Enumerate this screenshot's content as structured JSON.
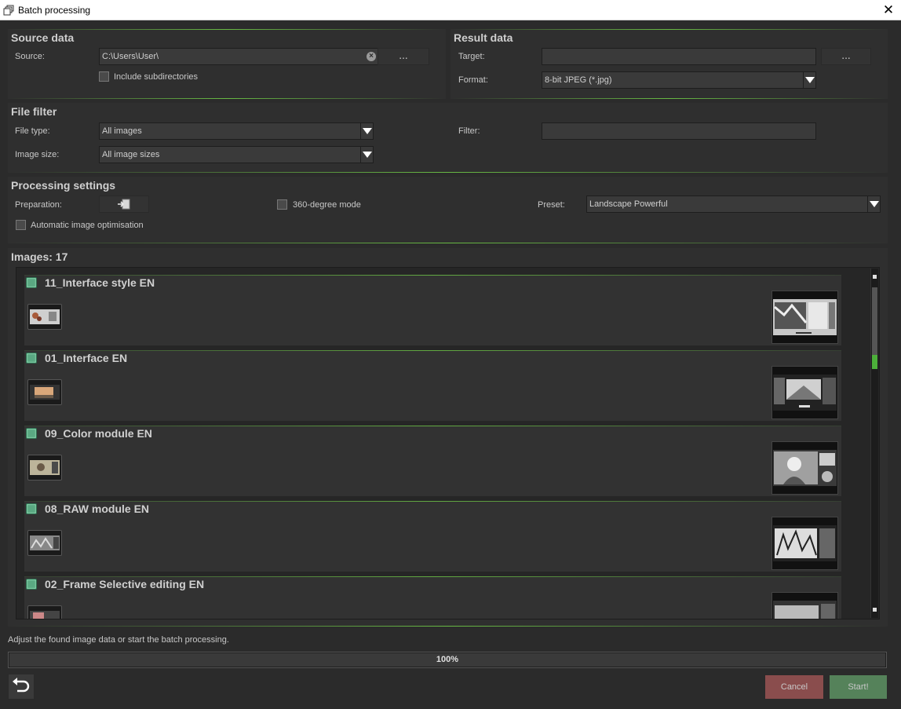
{
  "window": {
    "title": "Batch processing",
    "close": "✕"
  },
  "source_data": {
    "title": "Source data",
    "source_label": "Source:",
    "source_value": "C:\\Users\\User\\",
    "browse": "...",
    "include_subdirs": "Include subdirectories"
  },
  "result_data": {
    "title": "Result data",
    "target_label": "Target:",
    "target_value": "",
    "browse": "...",
    "format_label": "Format:",
    "format_value": "8-bit JPEG (*.jpg)"
  },
  "file_filter": {
    "title": "File filter",
    "file_type_label": "File type:",
    "file_type_value": "All images",
    "image_size_label": "Image size:",
    "image_size_value": "All image sizes",
    "filter_label": "Filter:",
    "filter_value": ""
  },
  "processing": {
    "title": "Processing settings",
    "preparation_label": "Preparation:",
    "mode_360": "360-degree mode",
    "preset_label": "Preset:",
    "preset_value": "Landscape Powerful",
    "auto_opt": "Automatic image optimisation"
  },
  "images": {
    "title": "Images: 17",
    "items": [
      {
        "name": "11_Interface style EN"
      },
      {
        "name": "01_Interface EN"
      },
      {
        "name": "09_Color module EN"
      },
      {
        "name": "08_RAW module EN"
      },
      {
        "name": "02_Frame Selective editing EN"
      }
    ]
  },
  "status": {
    "message": "Adjust the found image data or start the batch processing.",
    "progress_text": "100%",
    "progress_value": 1.0
  },
  "buttons": {
    "cancel": "Cancel",
    "start": "Start!"
  },
  "icons": {
    "app": "batch-processing-icon",
    "clear": "clear-icon",
    "preparation": "import-icon",
    "undo": "undo-icon"
  }
}
